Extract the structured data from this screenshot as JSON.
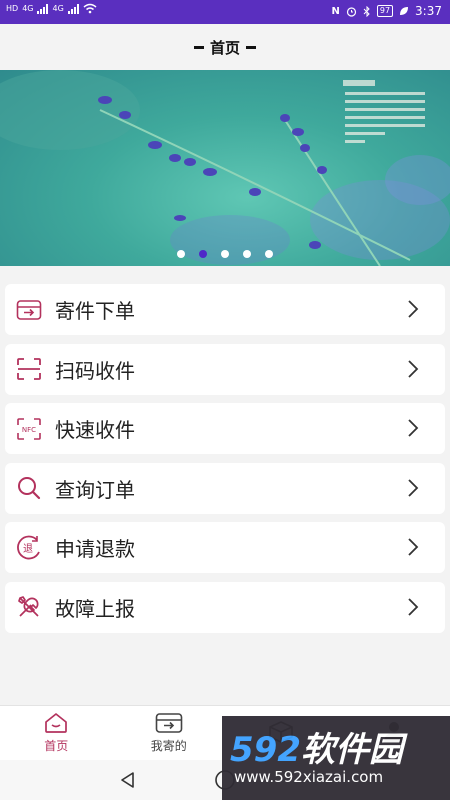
{
  "status_bar": {
    "net1": "HD",
    "net2": "4G",
    "net3": "4G",
    "battery": "97",
    "time": "3:37"
  },
  "header": {
    "title": "首页"
  },
  "banner": {
    "calendar_text": "2018.4",
    "slides": 5,
    "active_slide": 2
  },
  "menu": {
    "items": [
      {
        "label": "寄件下单",
        "icon": "send-box-icon"
      },
      {
        "label": "扫码收件",
        "icon": "scan-icon"
      },
      {
        "label": "快速收件",
        "icon": "nfc-icon"
      },
      {
        "label": "查询订单",
        "icon": "search-icon"
      },
      {
        "label": "申请退款",
        "icon": "refund-icon"
      },
      {
        "label": "故障上报",
        "icon": "tools-icon"
      }
    ]
  },
  "tabbar": {
    "tabs": [
      {
        "label": "首页",
        "icon": "home-icon",
        "active": true
      },
      {
        "label": "我寄的",
        "icon": "sent-box-icon",
        "active": false
      },
      {
        "label": "",
        "icon": "package-icon",
        "active": false
      },
      {
        "label": "",
        "icon": "user-icon",
        "active": false
      }
    ]
  },
  "watermark": {
    "brand_num": "592",
    "brand_text": "软件园",
    "url": "www.592xiazai.com"
  },
  "colors": {
    "status_bar": "#5a2fbf",
    "accent": "#b3325d",
    "dot_active": "#4f27c8"
  }
}
